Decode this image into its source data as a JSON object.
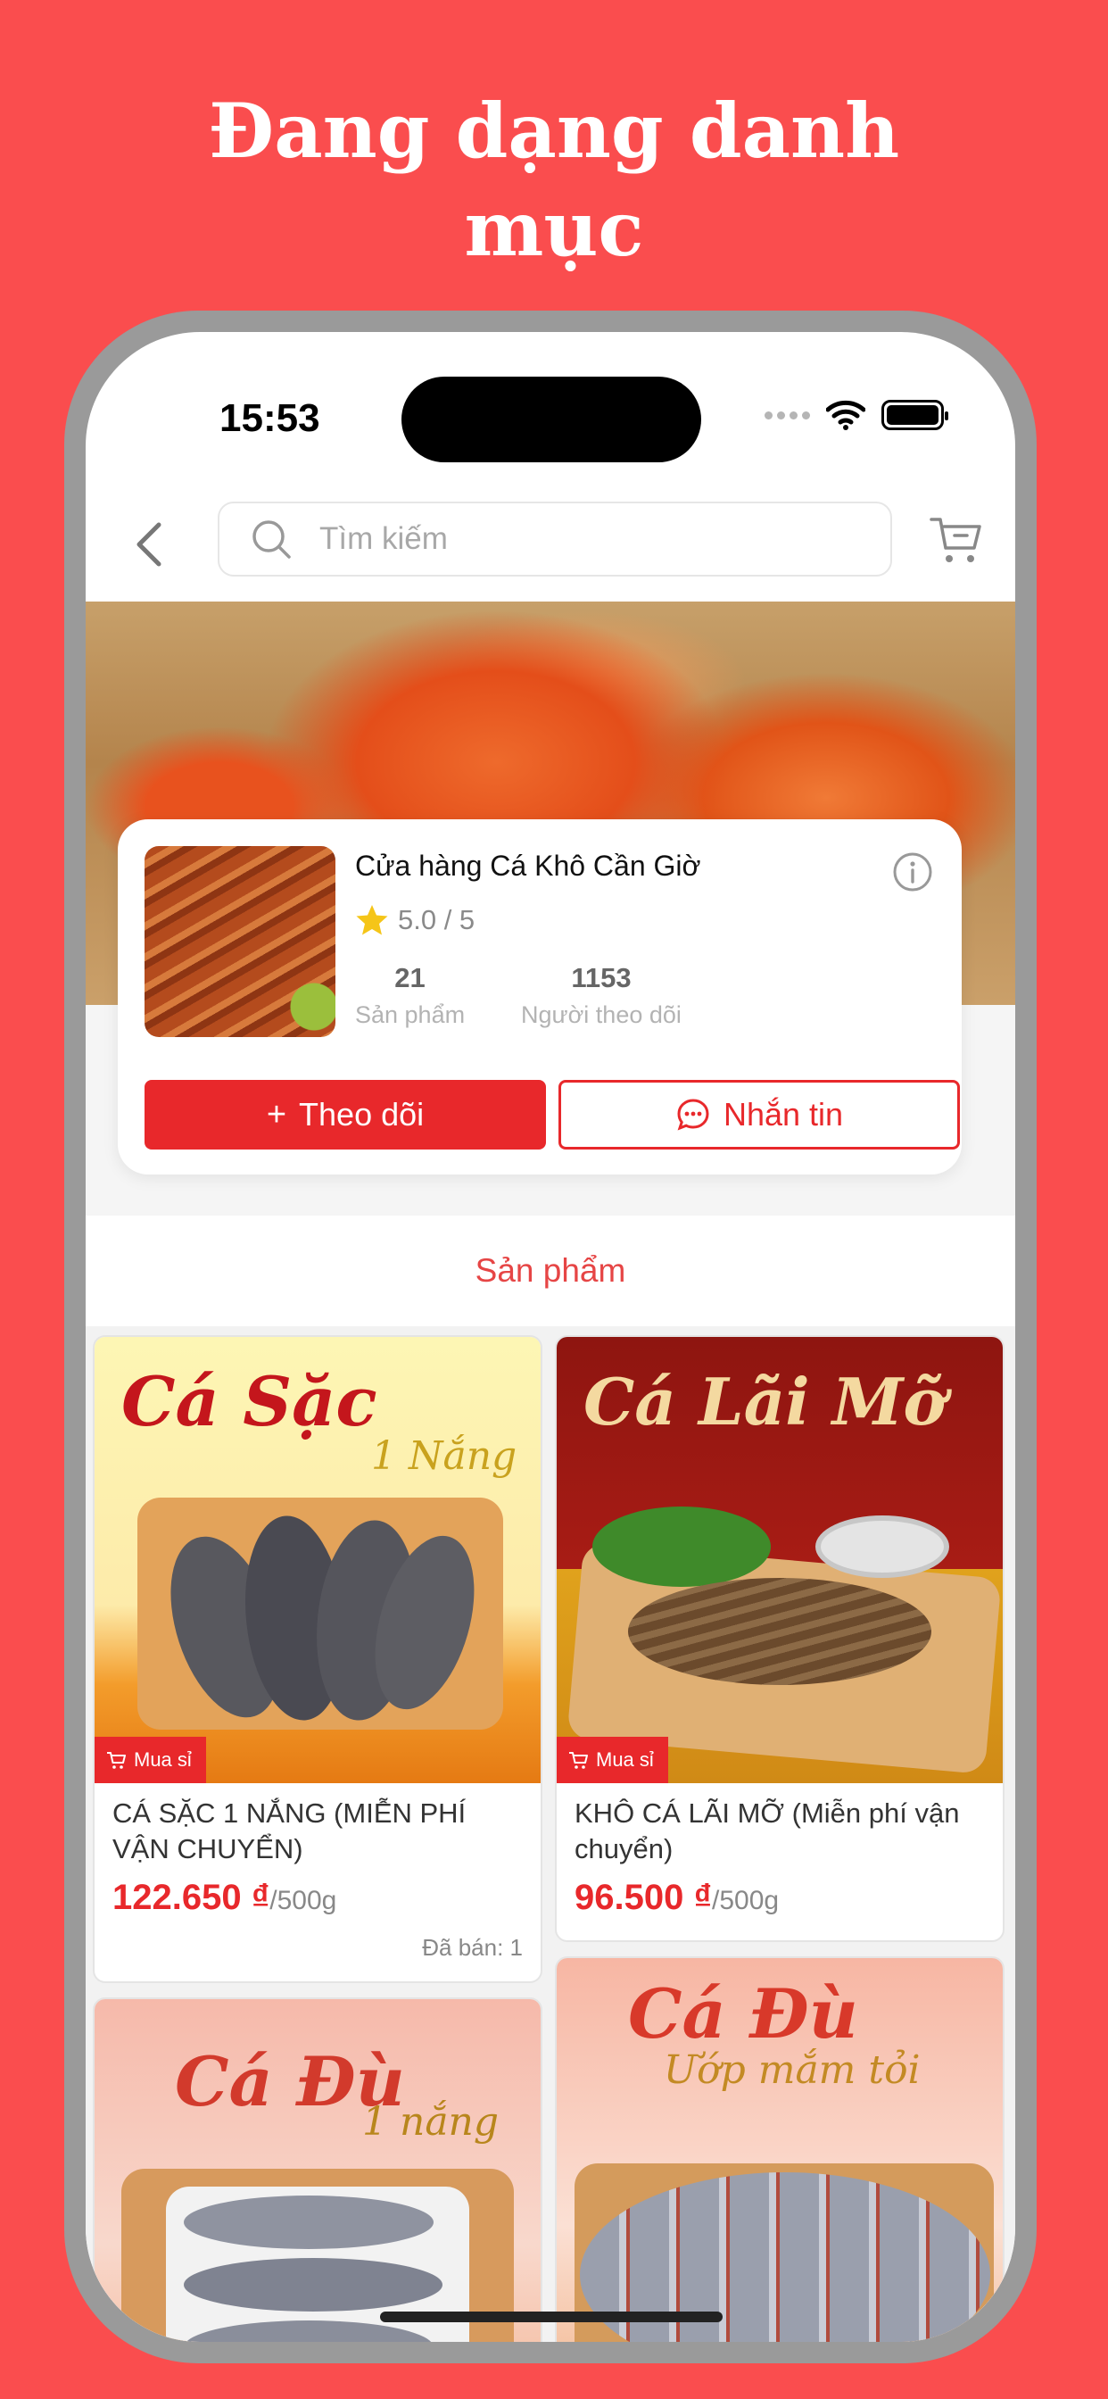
{
  "headline": {
    "line1": "Đang dạng danh",
    "line2": "mục"
  },
  "status_bar": {
    "time": "15:53"
  },
  "navbar": {
    "search_placeholder": "Tìm kiếm"
  },
  "store": {
    "name": "Cửa hàng Cá Khô Cần Giờ",
    "rating": "5.0 / 5",
    "products_count": "21",
    "products_label": "Sản phẩm",
    "followers_count": "1153",
    "followers_label": "Người theo dõi",
    "follow_label": "Theo dõi",
    "chat_label": "Nhắn tin"
  },
  "tabs": {
    "active": "Sản phẩm"
  },
  "products": [
    {
      "image_title": "Cá Sặc",
      "image_subtitle": "1 Nắng",
      "badge": "Mua sỉ",
      "name": "CÁ SẶC 1 NẮNG (MIỄN PHÍ VẬN CHUYỂN)",
      "price": "122.650 ₫",
      "unit": "/500g",
      "sold": "Đã bán: 1"
    },
    {
      "image_title": "Cá Lãi Mỡ",
      "badge": "Mua sỉ",
      "name": "KHÔ CÁ LÃI MỠ (Miễn phí vận chuyển)",
      "price": "96.500 ₫",
      "unit": "/500g"
    },
    {
      "image_title": "Cá Đù",
      "image_subtitle": "1 nắng"
    },
    {
      "image_title": "Cá Đù",
      "image_subtitle": "Ướp mắm tỏi"
    }
  ],
  "colors": {
    "brand_red": "#e8282b",
    "page_bg": "#fa4d4e",
    "star": "#f5c518"
  },
  "icons": [
    "back-icon",
    "search-icon",
    "cart-icon",
    "info-icon",
    "star-icon",
    "chat-icon",
    "cart-badge-icon"
  ]
}
